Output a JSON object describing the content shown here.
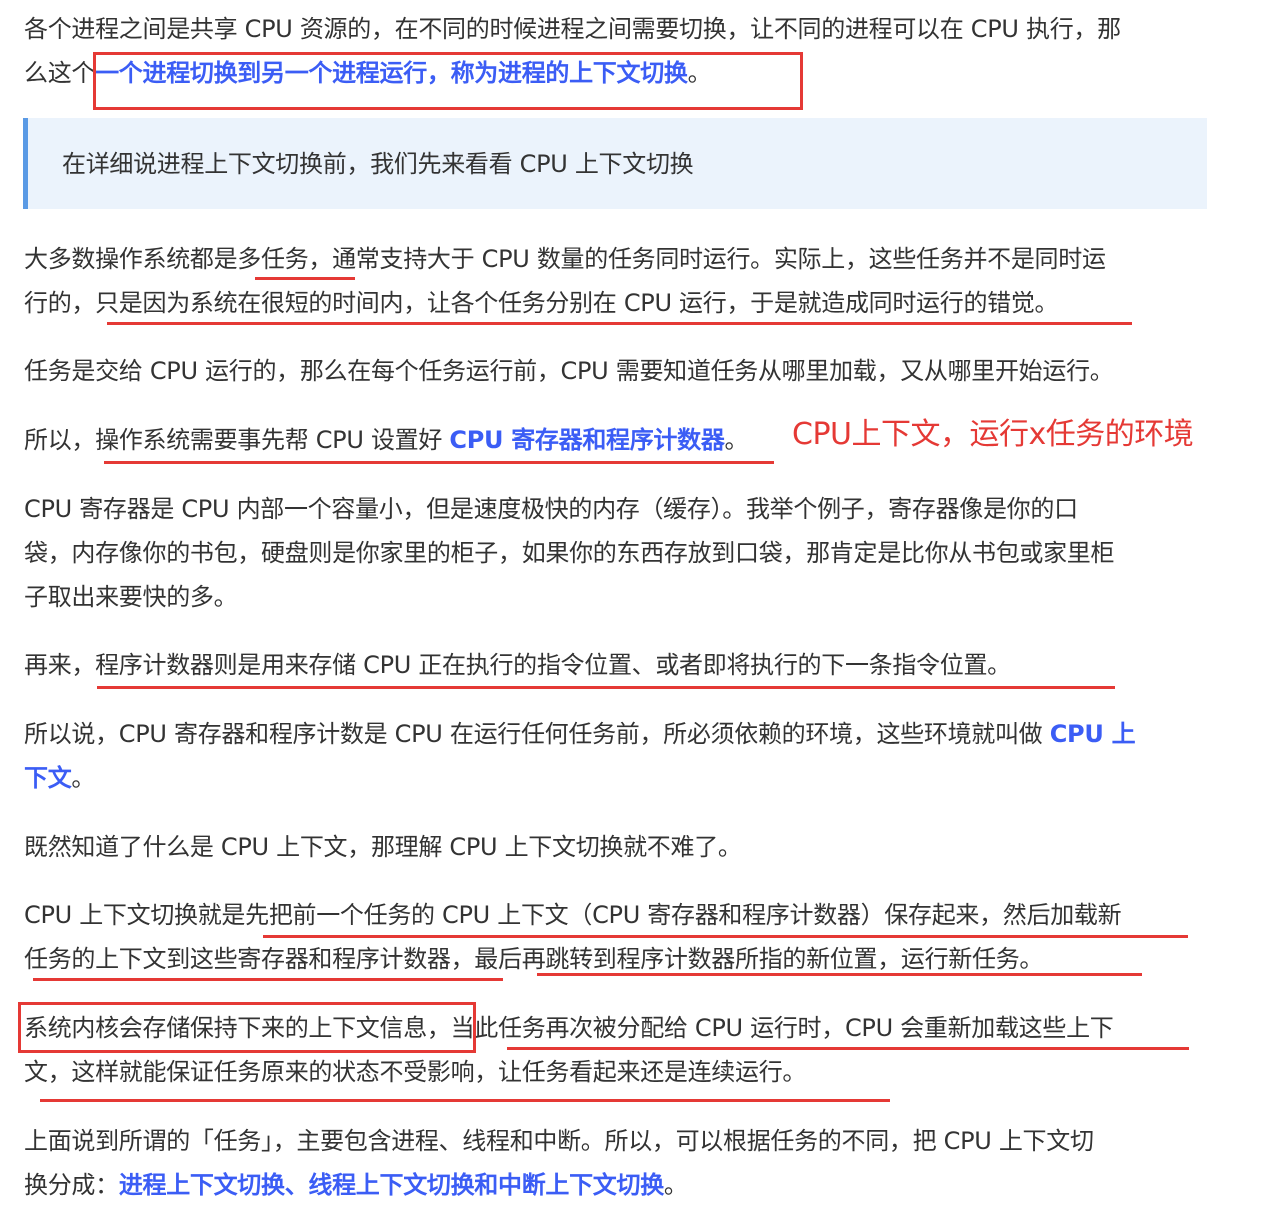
{
  "p1": {
    "l1": "各个进程之间是共享 CPU 资源的，在不同的时候进程之间需要切换，让不同的进程可以在 CPU 执行，那",
    "l2_a": "么这个",
    "l2_b": "一个进程切换到另一个进程运行，称为进程的上下文切换",
    "l2_c": "。"
  },
  "quote": "在详细说进程上下文切换前，我们先来看看 CPU 上下文切换",
  "p2": {
    "l1": "大多数操作系统都是多任务，通常支持大于 CPU 数量的任务同时运行。实际上，这些任务并不是同时运",
    "l2": "行的，只是因为系统在很短的时间内，让各个任务分别在 CPU 运行，于是就造成同时运行的错觉。"
  },
  "p3": "任务是交给 CPU 运行的，那么在每个任务运行前，CPU 需要知道任务从哪里加载，又从哪里开始运行。",
  "p4": {
    "a": "所以，操作系统需要事先帮 CPU 设置好 ",
    "b": "CPU 寄存器和程序计数器",
    "c": "。"
  },
  "annotation": "CPU上下文，运行x任务的环境",
  "p5": {
    "l1": "CPU 寄存器是 CPU 内部一个容量小，但是速度极快的内存（缓存）。我举个例子，寄存器像是你的口",
    "l2": "袋，内存像你的书包，硬盘则是你家里的柜子，如果你的东西存放到口袋，那肯定是比你从书包或家里柜",
    "l3": "子取出来要快的多。"
  },
  "p6": "再来，程序计数器则是用来存储 CPU 正在执行的指令位置、或者即将执行的下一条指令位置。",
  "p7": {
    "l1_a": "所以说，CPU 寄存器和程序计数是 CPU 在运行任何任务前，所必须依赖的环境，这些环境就叫做 ",
    "l1_b": "CPU 上",
    "l2_a": "下文",
    "l2_b": "。"
  },
  "p8": "既然知道了什么是 CPU 上下文，那理解 CPU 上下文切换就不难了。",
  "p9": {
    "l1": "CPU 上下文切换就是先把前一个任务的 CPU 上下文（CPU 寄存器和程序计数器）保存起来，然后加载新",
    "l2": "任务的上下文到这些寄存器和程序计数器，最后再跳转到程序计数器所指的新位置，运行新任务。"
  },
  "p10": {
    "l1": "系统内核会存储保持下来的上下文信息，当此任务再次被分配给 CPU 运行时，CPU 会重新加载这些上下",
    "l2": "文，这样就能保证任务原来的状态不受影响，让任务看起来还是连续运行。"
  },
  "p11": {
    "l1": "上面说到所谓的「任务」，主要包含进程、线程和中断。所以，可以根据任务的不同，把 CPU 上下文切",
    "l2_a": "换分成：",
    "l2_b": "进程上下文切换、线程上下文切换和中断上下文切换",
    "l2_c": "。"
  },
  "colors": {
    "link": "#3b5df5",
    "annotation_red": "#e53935",
    "quote_bg": "#ebf3fc",
    "quote_bar": "#5a9ae5"
  }
}
